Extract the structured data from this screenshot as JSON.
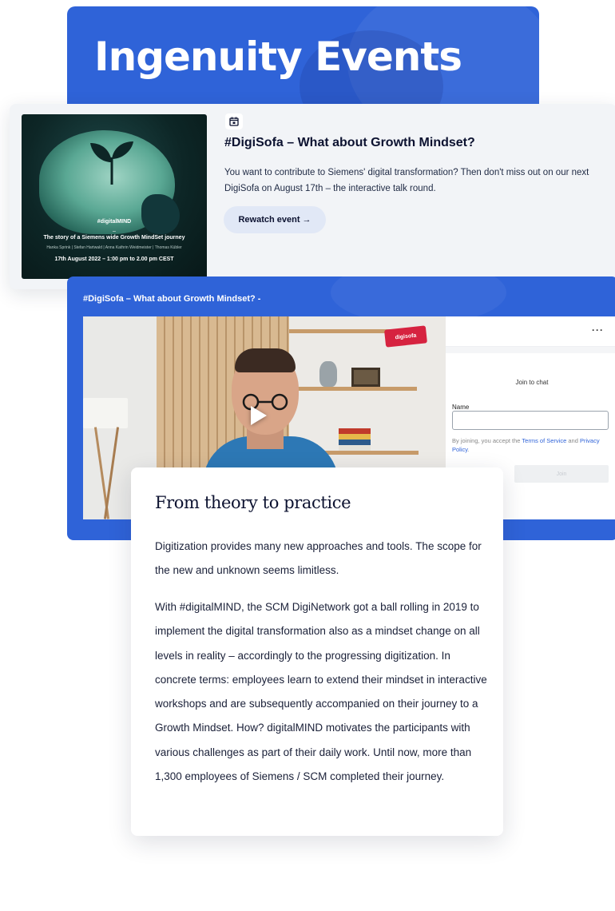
{
  "hero": {
    "title": "Ingenuity Events"
  },
  "event": {
    "icon": "calendar-icon",
    "title": "#DigiSofa – What about Growth Mindset?",
    "description": "You want to contribute to Siemens' digital transformation? Then don't miss out on our next DigiSofa on August 17th – the interactive talk round.",
    "button_label": "Rewatch event →",
    "thumbnail": {
      "tag": "#digitalMIND",
      "dash": "–",
      "story": "The story of a Siemens wide Growth MindSet journey",
      "names": "Hanka Sprink | Stefan Hartwald | Anna Kathrin Weidmeister | Thomas Kübler",
      "date": "17th August 2022 – 1:00 pm to 2.00 pm CEST"
    }
  },
  "player": {
    "title": "#DigiSofa – What about Growth Mindset? -",
    "badge": "digisofa",
    "chat": {
      "more": "···",
      "join_title": "Join to chat",
      "name_label": "Name",
      "name_value": "",
      "terms_prefix": "By joining, you accept the ",
      "terms_link": "Terms of Service",
      "terms_and": " and",
      "privacy_link": "Privacy Policy",
      "terms_suffix": ".",
      "join_button": "Join"
    }
  },
  "info": {
    "heading": "From theory to practice",
    "paragraph1": "Digitization provides many new approaches and tools. The scope for the new and unknown seems limitless.",
    "paragraph2": "With #digitalMIND, the SCM DigiNetwork got a ball rolling in 2019 to implement the digital transformation also as a mindset change on all levels in reality – accordingly to the progressing digitization. In concrete terms: employees learn to extend their mindset in interactive workshops and are subsequently accompanied on their journey to a Growth Mindset. How? digitalMIND motivates the participants with various challenges as part of their daily work. Until now, more than 1,300 employees of Siemens / SCM completed their journey."
  },
  "colors": {
    "brand_blue": "#2f63d8",
    "card_bg": "#f2f4f7",
    "button_bg": "#e1e8f6"
  }
}
